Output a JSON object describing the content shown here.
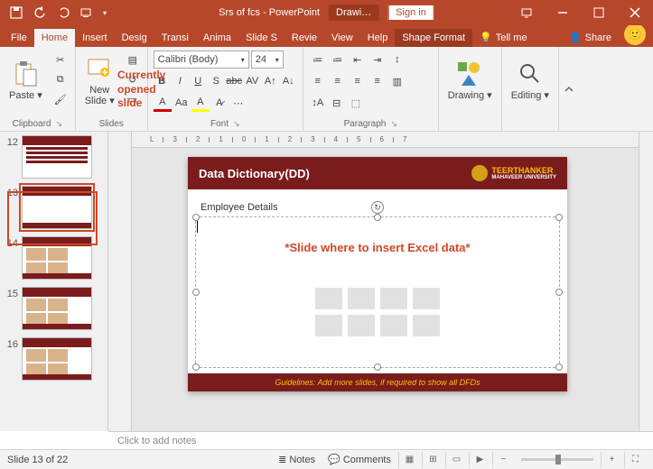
{
  "titlebar": {
    "title": "Srs of fcs - PowerPoint",
    "drawing": "Drawi…",
    "signin": "Sign in"
  },
  "tabs": {
    "file": "File",
    "home": "Home",
    "insert": "Insert",
    "design": "Desig",
    "transitions": "Transi",
    "animations": "Anima",
    "slideshow": "Slide S",
    "review": "Revie",
    "view": "View",
    "help": "Help",
    "shapeformat": "Shape Format",
    "tellme": "Tell me",
    "share": "Share"
  },
  "ribbon": {
    "clipboard": {
      "paste": "Paste",
      "label": "Clipboard"
    },
    "slides": {
      "newslide": "New\nSlide",
      "label": "Slides"
    },
    "font": {
      "name": "Calibri (Body)",
      "size": "24",
      "label": "Font"
    },
    "paragraph": {
      "label": "Paragraph"
    },
    "drawing": {
      "btn": "Drawing",
      "label": ""
    },
    "editing": {
      "btn": "Editing",
      "label": ""
    }
  },
  "thumbs": {
    "n12": "12",
    "n13": "13",
    "n14": "14",
    "n15": "15",
    "n16": "16"
  },
  "annotation": {
    "l1": "Currently",
    "l2": "opened",
    "l3": "slide"
  },
  "slide": {
    "title": "Data Dictionary(DD)",
    "uni1": "TEERTHANKER",
    "uni2": "MAHAVEER UNIVERSITY",
    "employee": "Employee Details",
    "insert": "*Slide where to insert Excel data*",
    "footer": "Guidelines: Add more slides, if required to show all DFDs"
  },
  "notes": {
    "placeholder": "Click to add notes"
  },
  "status": {
    "slide": "Slide 13 of 22",
    "notes": "Notes",
    "comments": "Comments",
    "zoom_minus": "−",
    "zoom_plus": "+"
  }
}
